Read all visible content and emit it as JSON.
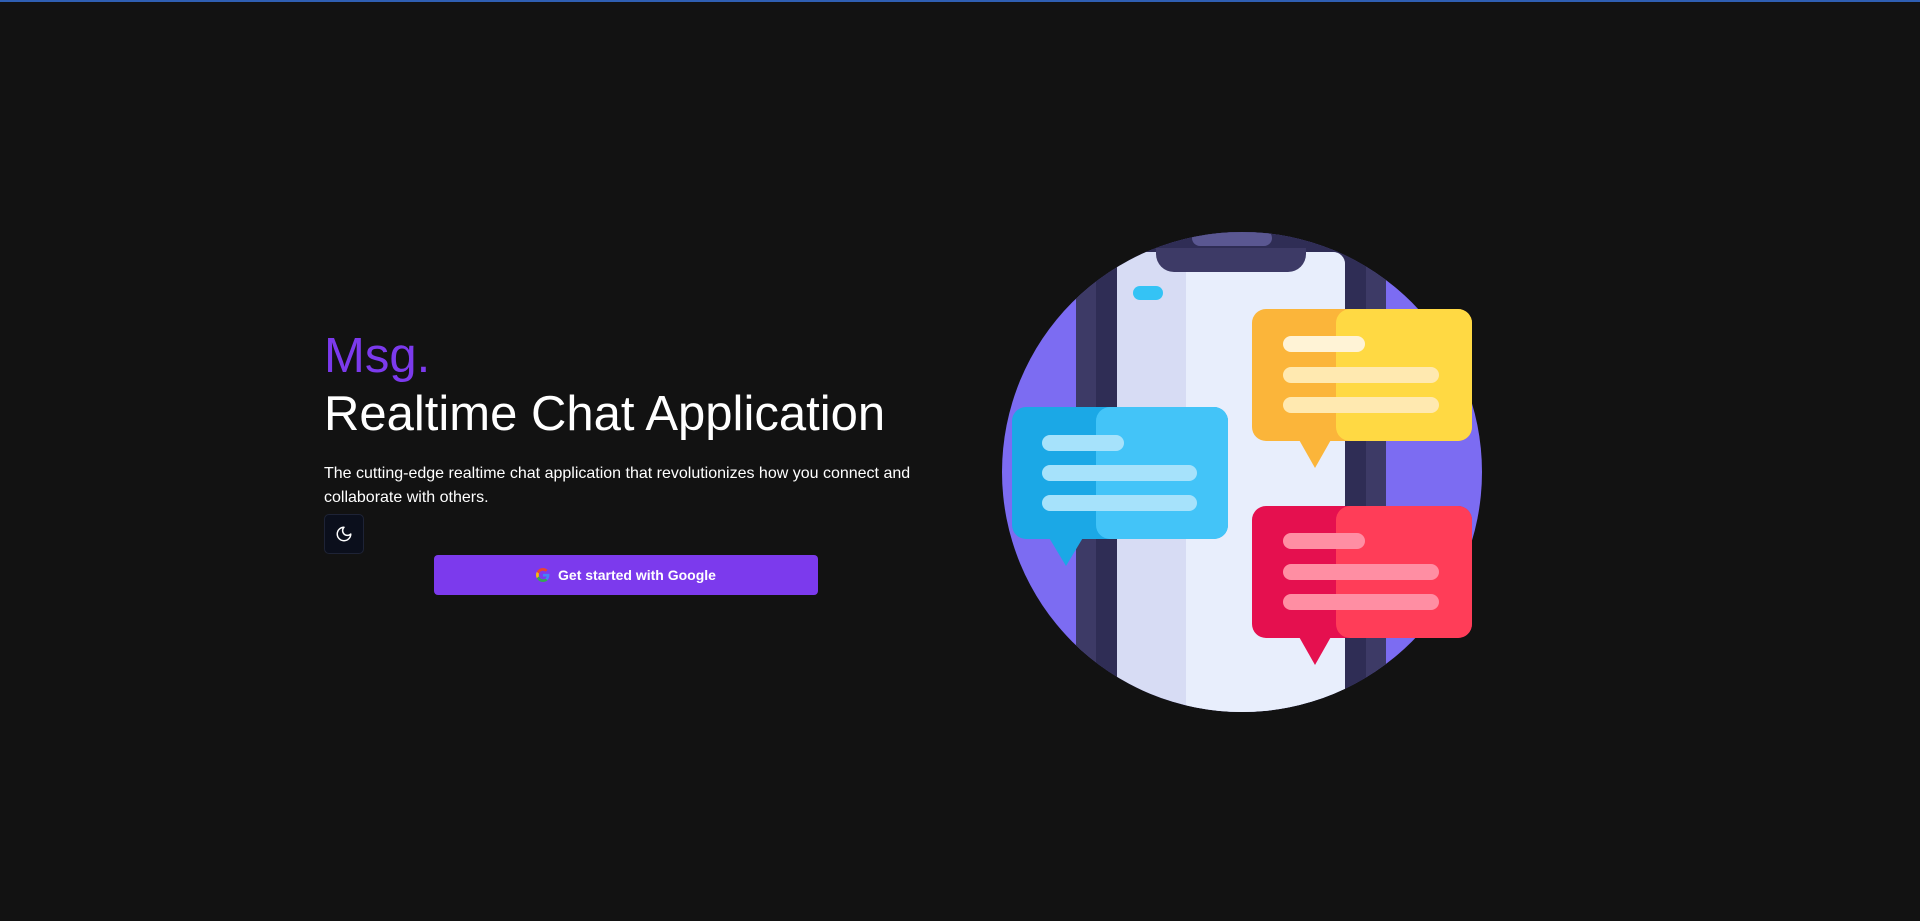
{
  "hero": {
    "brand": "Msg.",
    "headline": "Realtime Chat Application",
    "description": "The cutting-edge realtime chat application that revolutionizes how you connect and collaborate with others."
  },
  "theme_toggle": {
    "icon": "moon-icon"
  },
  "cta": {
    "label": "Get started with Google",
    "icon": "google-icon"
  },
  "illustration": {
    "name": "phone-chat-illustration"
  },
  "colors": {
    "background": "#121212",
    "accent": "#7c3aed",
    "top_line": "#2f5fb3"
  }
}
